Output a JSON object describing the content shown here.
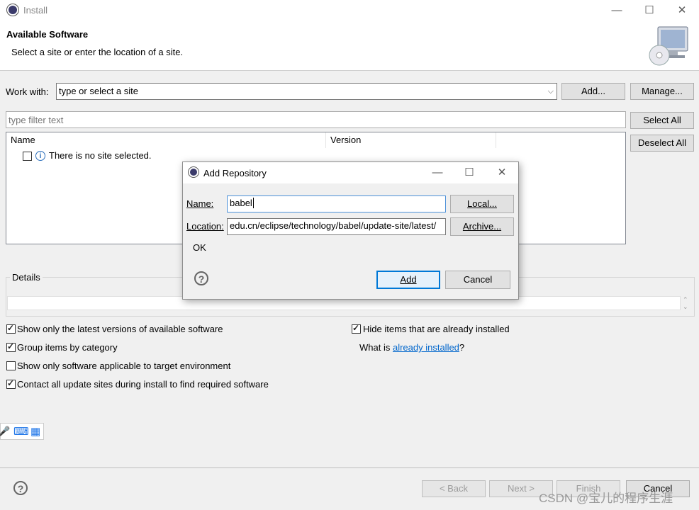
{
  "window": {
    "title": "Install"
  },
  "header": {
    "title": "Available Software",
    "subtitle": "Select a site or enter the location of a site."
  },
  "work_with": {
    "label": "Work with:",
    "value": "type or select a site",
    "add_label": "Add...",
    "manage_label": "Manage..."
  },
  "filter": {
    "placeholder": "type filter text"
  },
  "side_buttons": {
    "select_all": "Select All",
    "deselect_all": "Deselect All"
  },
  "table": {
    "columns": [
      "Name",
      "Version"
    ],
    "empty_message": "There is no site selected."
  },
  "details": {
    "label": "Details"
  },
  "options": {
    "show_latest": {
      "label": "Show only the latest versions of available software",
      "checked": true
    },
    "group_by_category": {
      "label": "Group items by category",
      "checked": true
    },
    "applicable_only": {
      "label": "Show only software applicable to target environment",
      "checked": false
    },
    "contact_all": {
      "label": "Contact all update sites during install to find required software",
      "checked": true
    },
    "hide_installed": {
      "label": "Hide items that are already installed",
      "checked": true
    },
    "what_is_prefix": "What is ",
    "what_is_link": "already installed",
    "what_is_suffix": "?"
  },
  "footer": {
    "back": "< Back",
    "next": "Next >",
    "finish": "Finish",
    "cancel": "Cancel"
  },
  "dialog": {
    "title": "Add Repository",
    "name_label": "Name:",
    "name_value": "babel",
    "location_label": "Location:",
    "location_value": "edu.cn/eclipse/technology/babel/update-site/latest/",
    "local_button": "Local...",
    "archive_button": "Archive...",
    "status": "OK",
    "add_button": "Add",
    "cancel_button": "Cancel"
  },
  "watermark": "CSDN @宝儿的程序生涯"
}
